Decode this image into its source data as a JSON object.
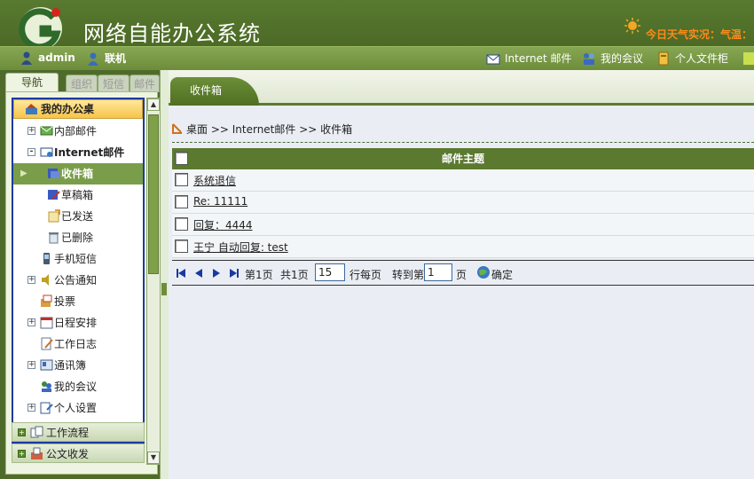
{
  "app": {
    "title": "网络自能办公系统",
    "weather": "今日天气实况：气温："
  },
  "toolbar": {
    "user": "admin",
    "status": "联机",
    "internet_mail": "Internet 邮件",
    "my_meeting": "我的会议",
    "personal_files": "个人文件柜"
  },
  "sidebar": {
    "tabs": [
      "导航",
      "组织",
      "短信",
      "邮件"
    ],
    "root": "我的办公桌",
    "items": [
      {
        "label": "内部邮件",
        "icon": "mail-icon",
        "expand": "+"
      },
      {
        "label": "Internet邮件",
        "icon": "internet-mail-icon",
        "expand": "-"
      },
      {
        "label": "收件箱",
        "icon": "inbox-icon"
      },
      {
        "label": "草稿箱",
        "icon": "drafts-icon"
      },
      {
        "label": "已发送",
        "icon": "sent-icon"
      },
      {
        "label": "已删除",
        "icon": "deleted-icon"
      },
      {
        "label": "手机短信",
        "icon": "phone-icon"
      },
      {
        "label": "公告通知",
        "icon": "speaker-icon",
        "expand": "+"
      },
      {
        "label": "投票",
        "icon": "vote-icon"
      },
      {
        "label": "日程安排",
        "icon": "calendar-icon",
        "expand": "+"
      },
      {
        "label": "工作日志",
        "icon": "log-icon"
      },
      {
        "label": "通讯簿",
        "icon": "address-book-icon",
        "expand": "+"
      },
      {
        "label": "我的会议",
        "icon": "meeting-icon"
      },
      {
        "label": "个人设置",
        "icon": "settings-icon",
        "expand": "+"
      }
    ],
    "sections": [
      "工作流程",
      "公文收发"
    ]
  },
  "main": {
    "tab": "收件箱",
    "breadcrumb": "桌面 >> Internet邮件 >> 收件箱",
    "grid": {
      "header": "邮件主题",
      "rows": [
        "系统退信",
        "Re: 11111",
        "回复：4444",
        "王宁 自动回复: test"
      ]
    },
    "pager": {
      "page_info": "第1页",
      "total": "共1页",
      "per_page": "15",
      "per_page_label": "行每页",
      "goto_label": "转到第",
      "goto_value": "1",
      "page_suffix": "页",
      "confirm": "确定"
    }
  }
}
